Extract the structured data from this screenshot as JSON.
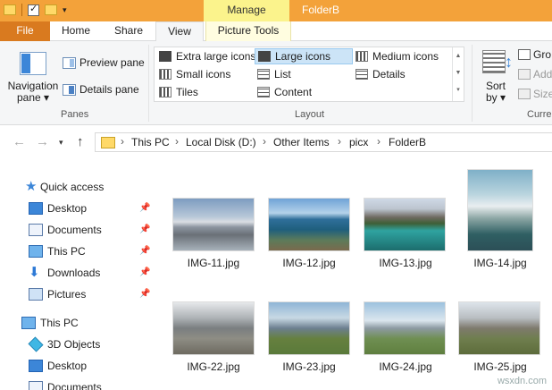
{
  "titlebar": {
    "context_tab": "Manage",
    "window_title": "FolderB"
  },
  "tabs": {
    "file": "File",
    "home": "Home",
    "share": "Share",
    "view": "View",
    "picture_tools": "Picture Tools"
  },
  "ribbon": {
    "panes": {
      "navigation_pane": "Navigation\npane ▾",
      "navigation_pane_line1": "Navigation",
      "navigation_pane_line2": "pane ▾",
      "preview_pane": "Preview pane",
      "details_pane": "Details pane",
      "group_label": "Panes"
    },
    "layout": {
      "extra_large_icons": "Extra large icons",
      "large_icons": "Large icons",
      "medium_icons": "Medium icons",
      "small_icons": "Small icons",
      "list": "List",
      "details": "Details",
      "tiles": "Tiles",
      "content": "Content",
      "group_label": "Layout",
      "selected": "Large icons"
    },
    "current_view": {
      "sort_by_line1": "Sort",
      "sort_by_line2": "by ▾",
      "group_by": "Gro",
      "add": "Add",
      "size": "Size",
      "group_label": "Curre"
    }
  },
  "address": {
    "crumbs": [
      "This PC",
      "Local Disk (D:)",
      "Other Items",
      "picx",
      "FolderB"
    ]
  },
  "navtree": {
    "quick_access": "Quick access",
    "items": [
      {
        "label": "Desktop",
        "pinned": true
      },
      {
        "label": "Documents",
        "pinned": true
      },
      {
        "label": "This PC",
        "pinned": true
      },
      {
        "label": "Downloads",
        "pinned": true
      },
      {
        "label": "Pictures",
        "pinned": true
      }
    ],
    "this_pc": "This PC",
    "pc_items": [
      "3D Objects",
      "Desktop",
      "Documents"
    ]
  },
  "files": [
    {
      "name": "IMG-11.jpg"
    },
    {
      "name": "IMG-12.jpg"
    },
    {
      "name": "IMG-13.jpg"
    },
    {
      "name": "IMG-14.jpg"
    },
    {
      "name": "IMG-22.jpg"
    },
    {
      "name": "IMG-23.jpg"
    },
    {
      "name": "IMG-24.jpg"
    },
    {
      "name": "IMG-25.jpg"
    }
  ],
  "watermark": "wsxdn.com",
  "colors": {
    "title_bar": "#f3a23a",
    "manage_tab": "#fbf38c",
    "file_tab": "#d97a1f",
    "selection": "#cce4f7",
    "accent": "#3c86d8"
  }
}
